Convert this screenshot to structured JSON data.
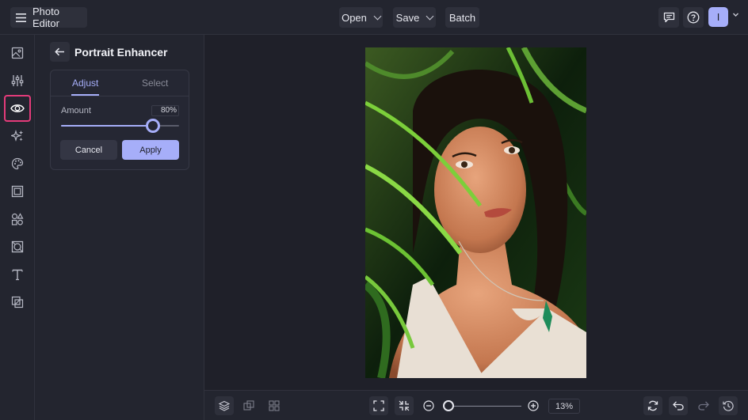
{
  "header": {
    "app_title": "Photo Editor",
    "open_label": "Open",
    "save_label": "Save",
    "batch_label": "Batch",
    "avatar_initial": "I"
  },
  "sidebar": {
    "items": [
      {
        "name": "image-icon"
      },
      {
        "name": "sliders-icon"
      },
      {
        "name": "eye-icon",
        "active": true
      },
      {
        "name": "sparkle-icon"
      },
      {
        "name": "palette-icon"
      },
      {
        "name": "frame-icon"
      },
      {
        "name": "shapes-icon"
      },
      {
        "name": "texture-icon"
      },
      {
        "name": "text-icon"
      },
      {
        "name": "overlay-icon"
      }
    ]
  },
  "panel": {
    "title": "Portrait Enhancer",
    "tabs": [
      "Adjust",
      "Select"
    ],
    "active_tab": "Adjust",
    "amount_label": "Amount",
    "amount_value": "80%",
    "amount_fraction": 0.78,
    "cancel_label": "Cancel",
    "apply_label": "Apply"
  },
  "footer": {
    "zoom_value": "13%",
    "zoom_fraction": 0.0
  },
  "colors": {
    "accent": "#a6aef9",
    "active_outline": "#e43b7a",
    "background": "#1f2029",
    "surface": "#23252f"
  }
}
